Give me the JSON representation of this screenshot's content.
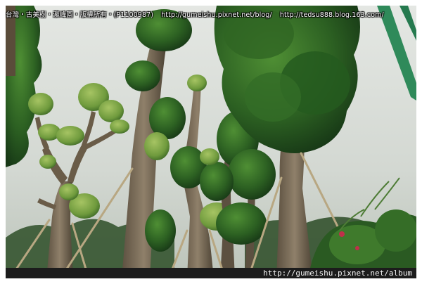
{
  "caption": {
    "text1": "台灣・古美樹・瀛峰園・版權所有・(P1100987)",
    "text2": "http://gumeishu.pixnet.net/blog/",
    "text3": "http://tedsu888.blog.163.com/"
  },
  "watermark": {
    "url": "http://gumeishu.pixnet.net/album"
  },
  "colors": {
    "sky": "#d8ddd8",
    "foliage_dark": "#1f4d1c",
    "foliage_mid": "#3e7a2a",
    "foliage_light": "#8fb552",
    "trunk": "#7a6a55",
    "bar": "#1c1c1c",
    "pole_green": "#2f8a5a"
  }
}
